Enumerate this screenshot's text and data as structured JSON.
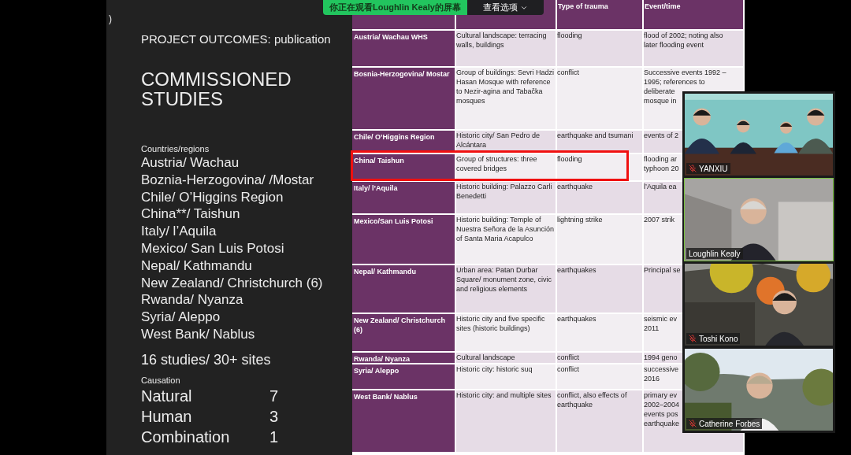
{
  "share_banner": {
    "viewing": "你正在观看Loughlin  Kealy的屏幕",
    "options": "查看选项"
  },
  "slide": {
    "corner_mark": ")",
    "title": "PROJECT OUTCOMES: publication",
    "heading": "COMMISSIONED STUDIES",
    "countries_label": "Countries/regions",
    "countries": [
      "Austria/ Wachau",
      "Boznia-Herzogovina/ /Mostar",
      "Chile/ O’Higgins Region",
      "China**/ Taishun",
      "Italy/ l’Aquila",
      "Mexico/ San Luis Potosi",
      "Nepal/ Kathmandu",
      "New Zealand/ Christchurch (6)",
      "Rwanda/ Nyanza",
      "Syria/ Aleppo",
      "West Bank/ Nablus"
    ],
    "summary": "16 studies/ 30+ sites",
    "causation_label": "Causation",
    "causation": [
      {
        "label": "Natural",
        "count": "7"
      },
      {
        "label": "Human",
        "count": "3"
      },
      {
        "label": "Combination",
        "count": "1"
      }
    ]
  },
  "table": {
    "columns": [
      {
        "label": "Type of trauma"
      },
      {
        "label": "Event/time"
      }
    ],
    "rows": [
      {
        "site": "Austria/ Wachau WHS",
        "heritage": "Cultural landscape: terracing walls, buildings",
        "trauma": "flooding",
        "event": [
          "flood of 2002; noting also",
          "later flooding event"
        ],
        "highlighted": false
      },
      {
        "site": "Bosnia-Herzogovina/ Mostar",
        "heritage": "Group of buildings: Sevri Hadzi Hasan Mosque with reference to Nezir-agina and Tabačka mosques",
        "trauma": "conflict",
        "event": [
          "Successive events 1992 –",
          "1995; references to",
          "deliberate",
          "mosque in"
        ],
        "highlighted": false
      },
      {
        "site": "Chile/ O’Higgins Region",
        "heritage": "Historic city/ San Pedro de Alcántara",
        "trauma": "earthquake and tsumani",
        "event": [
          "events of 2"
        ],
        "highlighted": false
      },
      {
        "site": "China/ Taishun",
        "heritage": "Group of structures: three covered bridges",
        "trauma": "flooding",
        "event": [
          "flooding ar",
          "typhoon 20"
        ],
        "highlighted": true
      },
      {
        "site": "Italy/ l’Aquila",
        "heritage": "Historic building: Palazzo Carli Benedetti",
        "trauma": "earthquake",
        "event": [
          "l’Aquila ea"
        ],
        "highlighted": false
      },
      {
        "site": "Mexico/San Luis Potosi",
        "heritage": "Historic building: Temple of Nuestra Señora de la Asunción of Santa Maria Acapulco",
        "trauma": "lightning strike",
        "event": [
          "2007 strik"
        ],
        "highlighted": false
      },
      {
        "site": "Nepal/ Kathmandu",
        "heritage": "Urban area: Patan Durbar Square/ monument zone, civic and religious elements",
        "trauma": "earthquakes",
        "event": [
          "Principal se"
        ],
        "highlighted": false
      },
      {
        "site": "New Zealand/ Christchurch (6)",
        "heritage": "Historic city and five specific sites (historic buildings)",
        "trauma": "earthquakes",
        "event": [
          "seismic ev",
          "2011"
        ],
        "highlighted": false
      },
      {
        "site": "Rwanda/ Nyanza",
        "heritage": "Cultural landscape",
        "trauma": "conflict",
        "event": [
          "1994 geno"
        ],
        "highlighted": false
      },
      {
        "site": "Syria/ Aleppo",
        "heritage": "Historic city: historic suq",
        "trauma": "conflict",
        "event": [
          "successive",
          "2016"
        ],
        "highlighted": false
      },
      {
        "site": "West Bank/ Nablus",
        "heritage": "Historic city: and multiple sites",
        "trauma": "conflict, also effects of earthquake",
        "event": [
          "primary ev",
          "2002–2004",
          "events pos",
          "earthquake"
        ],
        "highlighted": false
      }
    ]
  },
  "participants": [
    {
      "name": "YANXIU",
      "muted": true,
      "speaking": false
    },
    {
      "name": "Loughlin Kealy",
      "muted": false,
      "speaking": true
    },
    {
      "name": "Toshi Kono",
      "muted": true,
      "speaking": false
    },
    {
      "name": "Catherine Forbes",
      "muted": true,
      "speaking": false
    }
  ]
}
